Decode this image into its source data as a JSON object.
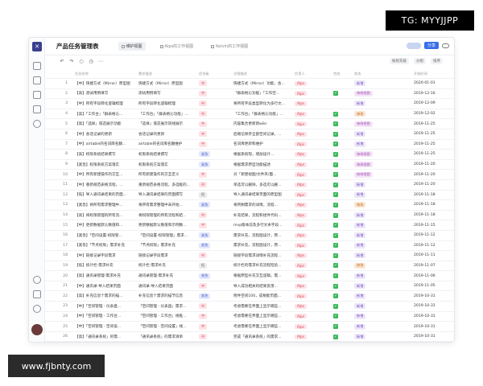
{
  "overlays": {
    "tg_badge": "TG: MYYJJPP",
    "watermark": "www.fjbnty.com"
  },
  "app": {
    "title": "产品任务管理表",
    "tabs": [
      {
        "label": "维护视图",
        "active": true
      },
      {
        "label": "Alps的工作视图",
        "active": false
      },
      {
        "label": "Kelvin的工作视图",
        "active": false
      }
    ],
    "share_label": "分享"
  },
  "toolbar": {
    "chips": [
      "按优先级",
      "分组",
      "排序"
    ]
  },
  "columns": {
    "a": "任务名称",
    "b": "需求描述",
    "c": "优先级",
    "d": "详细描述",
    "e": "负责人",
    "f": "完成",
    "g": "状态",
    "h": "开始时间"
  },
  "rows": [
    {
      "n": "1",
      "a": "【中】快捷方式（Mirror）原型图",
      "b": "快捷方式（Mirror）原型图",
      "c": "中",
      "d": "快捷方式（Mirror）功能，会...",
      "e": "Alps",
      "f": false,
      "g": "新增",
      "h": "2020-01-01"
    },
    {
      "n": "2",
      "a": "【高】测试用例填写",
      "b": "测试用例填写",
      "c": "中",
      "d": "「群表格沁功能」「工作空...",
      "e": "Alps",
      "f": true,
      "g": "修改视图",
      "h": "2019-12-16"
    },
    {
      "n": "3",
      "a": "【中】所有字段转化逻辑梳理",
      "b": "所有字段转化逻辑梳理",
      "c": "中",
      "d": "将所有字段类型转化为多行文...",
      "e": "Alps",
      "f": false,
      "g": "新增",
      "h": "2019-12-09"
    },
    {
      "n": "4",
      "a": "【高】「工作台」「群表格沁...",
      "b": "「工作台」「群表格沁功能」...",
      "c": "中",
      "d": "「工作台」「群表格沁功能」...",
      "e": "Alps",
      "f": true,
      "g": "修改",
      "h": "2019-12-02"
    },
    {
      "n": "5",
      "a": "【高】「选择」值态展示功能",
      "b": "「选择」值态展示同线展示",
      "c": "中",
      "d": "内容集合更新新wiki",
      "e": "Alps",
      "f": true,
      "g": "修改视图",
      "h": "2019-11-25"
    },
    {
      "n": "6",
      "a": "【中】会话记录的更新",
      "b": "会话记录的更新",
      "c": "中",
      "d": "后端信保存全部空间记录，...",
      "e": "Alps",
      "f": true,
      "g": "新增",
      "h": "2019-11-25"
    },
    {
      "n": "7",
      "a": "【中】airtable的名词库名翻...",
      "b": "airtable的名词库名翻维护",
      "c": "中",
      "d": "名词库更新和维护",
      "e": "Alps",
      "f": true,
      "g": "新增",
      "h": "2019-11-25"
    },
    {
      "n": "8",
      "a": "【高】权限系统结果撰写",
      "b": "权限系统结果撰写",
      "c": "紧急",
      "d": "根据系统现，增加设计...",
      "e": "Alps",
      "f": true,
      "g": "修改视图",
      "h": "2019-11-25"
    },
    {
      "n": "9",
      "a": "【紧急】权限系统方案落实",
      "b": "权限系统方案落实",
      "c": "紧急",
      "d": "根据需求原型功能描述",
      "e": "Alps",
      "f": true,
      "g": "修改视图",
      "h": "2019-11-20"
    },
    {
      "n": "10",
      "a": "【中】所有新建操作的交互...",
      "b": "所有新建操作的交互定义",
      "c": "中",
      "d": "对「新建视图/文件夹/面...",
      "e": "Alps",
      "f": true,
      "g": "修改视图",
      "h": "2019-11-20"
    },
    {
      "n": "11",
      "a": "【中】重新规范表格流程，...",
      "b": "重新规范表格流程，多选框的...",
      "c": "中",
      "d": "单选可以删除，多选可以删...",
      "e": "Alps",
      "f": true,
      "g": "新增",
      "h": "2019-11-20"
    },
    {
      "n": "12",
      "a": "【低】导入通讯录结果的页面...",
      "b": "导入通讯录结果的页面撰写",
      "c": "低",
      "d": "导入通讯录结果页面的原型图",
      "e": "Alps",
      "f": true,
      "g": "新增",
      "h": "2019-11-18"
    },
    {
      "n": "13",
      "a": "【紧急】将所有需求整理中...",
      "b": "将所有需求整理中未开始...",
      "c": "紧急",
      "d": "将所剩需求的详情，流程...",
      "e": "Alps",
      "f": true,
      "g": "修改",
      "h": "2019-11-18"
    },
    {
      "n": "14",
      "a": "【高】将权限管理的所有流...",
      "b": "将权限管理的所有流程和结...",
      "c": "中",
      "d": "补充结果，流程和组件代码...",
      "e": "Alps",
      "f": true,
      "g": "新增",
      "h": "2019-11-18"
    },
    {
      "n": "15",
      "a": "【中】更新数据默认数值和...",
      "b": "更新数据默认数值和示例数...",
      "c": "中",
      "d": "mvp版本前及多行文本字段...",
      "e": "Alps",
      "f": true,
      "g": "新增",
      "h": "2019-11-15"
    },
    {
      "n": "16",
      "a": "【紧急】「空间设置-权限管...",
      "b": "「空间设置-权限管理」需求...",
      "c": "紧急",
      "d": "需求补充，流程图设计，原...",
      "e": "Alps",
      "f": true,
      "g": "新增",
      "h": "2019-11-12"
    },
    {
      "n": "17",
      "a": "【紧急】「节点权限」需求补充",
      "b": "「节点权限」需求补充",
      "c": "紧急",
      "d": "需求补充，流程图设计，原...",
      "e": "Alps",
      "f": true,
      "g": "新增",
      "h": "2019-11-12"
    },
    {
      "n": "18",
      "a": "【中】链接记录字段需求",
      "b": "链接记录字段需求",
      "c": "中",
      "d": "链接字段需求详情补充流程...",
      "e": "Alps",
      "f": true,
      "g": "新增",
      "h": "2019-11-11"
    },
    {
      "n": "19",
      "a": "【低】统计栏-需求补充",
      "b": "统计栏-需求补充",
      "c": "低",
      "d": "统计栏的需求补充流程检验...",
      "e": "Alps",
      "f": true,
      "g": "修改",
      "h": "2019-11-07"
    },
    {
      "n": "20",
      "a": "【高】通讯录管理-需求补充",
      "b": "通讯录管理-需求补充",
      "c": "紧急",
      "d": "根据原型补充交互逻辑，需...",
      "e": "Alps",
      "f": true,
      "g": "新增",
      "h": "2019-11-06"
    },
    {
      "n": "21",
      "a": "【中】通讯录-导入结果页面",
      "b": "通讯录-导入结果页面",
      "c": "中",
      "d": "导入成功相关的结果反馈...",
      "e": "Alps",
      "f": true,
      "g": "新增",
      "h": "2019-11-05"
    },
    {
      "n": "22",
      "a": "【高】补充信息个需求的描...",
      "b": "补充信息个需求的描节信息",
      "c": "紧急",
      "d": "附件空间100，成根能页面...",
      "e": "Alps",
      "f": true,
      "g": "新增",
      "h": "2019-10-31"
    },
    {
      "n": "23",
      "a": "【中】「空间管理 - 仪表盘...",
      "b": "「空间管理 - 仪表盘」需求...",
      "c": "中",
      "d": "考虑需要在界面上显示哪些...",
      "e": "Alps",
      "f": true,
      "g": "新增",
      "h": "2019-10-31"
    },
    {
      "n": "24",
      "a": "【中】「空间管理 - 工作台...",
      "b": "「空间管理 - 工作台」线框...",
      "c": "中",
      "d": "考虑需要在界面上显示哪些...",
      "e": "Alps",
      "f": true,
      "g": "新增",
      "h": "2019-10-31"
    },
    {
      "n": "25",
      "a": "【中】「空间管理 - 空间设...",
      "b": "「空间管理 - 空间设置」线...",
      "c": "中",
      "d": "考虑需要在界面上显示哪些...",
      "e": "Alps",
      "f": true,
      "g": "新增",
      "h": "2019-10-31"
    },
    {
      "n": "26",
      "a": "【高】「通讯录系统」的需...",
      "b": "「通讯录系统」的需求清单",
      "c": "中",
      "d": "完成「通讯录系统」的需求...",
      "e": "Alps",
      "f": true,
      "g": "新增",
      "h": "2019-10-31"
    }
  ]
}
